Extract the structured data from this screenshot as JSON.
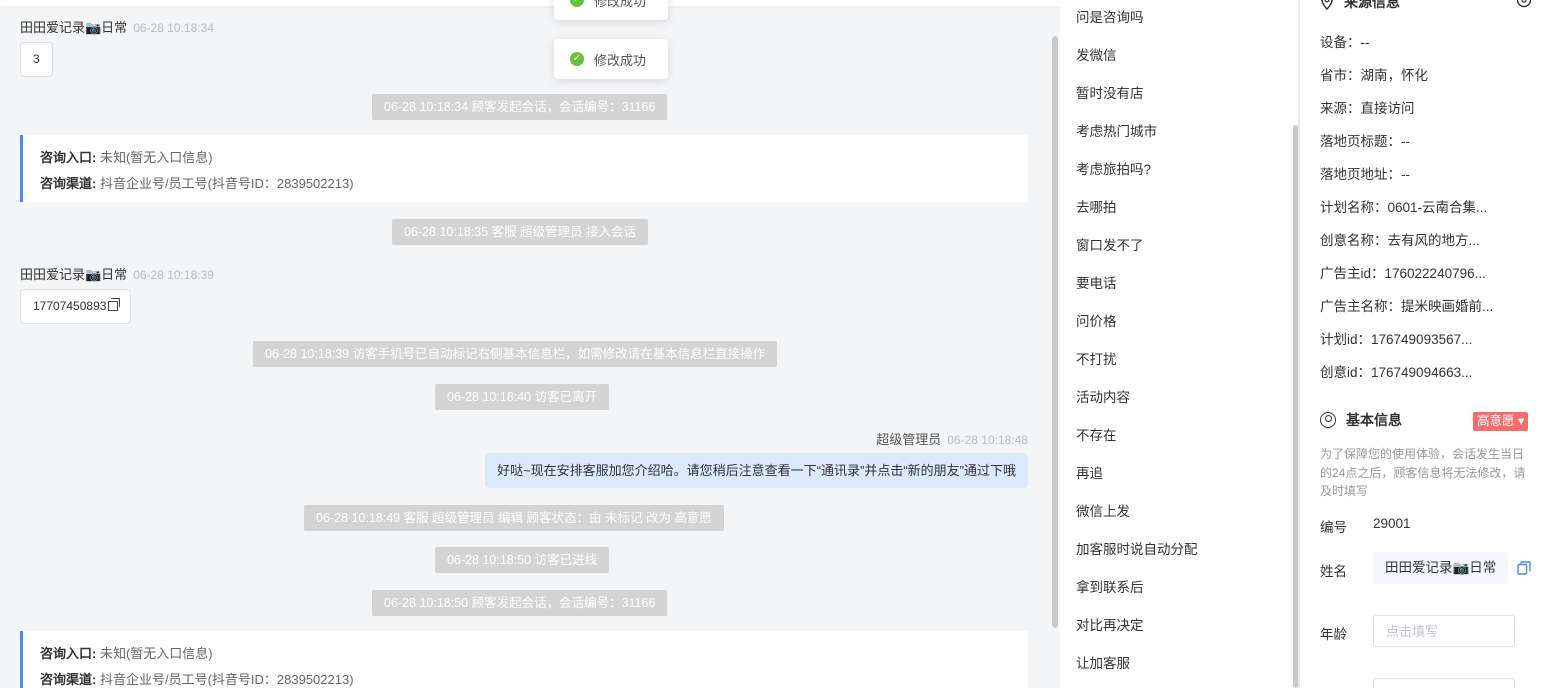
{
  "toasts": [
    {
      "text": "修改成功"
    },
    {
      "text": "修改成功"
    }
  ],
  "chat": {
    "msg1": {
      "sender": "田田爱记录📷日常",
      "time": "06-28 10:18:34",
      "content": "3"
    },
    "sys1": "06-28 10:18:34 顾客发起会话，会话编号：31166",
    "card1": {
      "entry_label": "咨询入口:",
      "entry_value": "未知(暂无入口信息)",
      "channel_label": "咨询渠道:",
      "channel_value": "抖音企业号/员工号(抖音号ID：2839502213)"
    },
    "sys2": "06-28 10:18:35 客服 超级管理员 接入会话",
    "msg2": {
      "sender": "田田爱记录📷日常",
      "time": "06-28 10:18:39",
      "content": "17707450893"
    },
    "sys3": "06-28 10:18:39 访客手机号已自动标记右侧基本信息栏，如需修改请在基本信息栏直接操作",
    "sys4": "06-28 10:18:40 访客已离开",
    "agent": {
      "name": "超级管理员",
      "time": "06-28 10:18:48",
      "content": "好哒~现在安排客服加您介绍哈。请您稍后注意查看一下“通讯录”并点击“新的朋友”通过下哦"
    },
    "sys5": "06-28 10:18:49 客服 超级管理员 编辑 顾客状态：由 未标记 改为 高意愿",
    "sys6": "06-28 10:18:50 访客已进线",
    "sys7": "06-28 10:18:50 顾客发起会话，会话编号：31166",
    "card2": {
      "entry_label": "咨询入口:",
      "entry_value": "未知(暂无入口信息)",
      "channel_label": "咨询渠道:",
      "channel_value": "抖音企业号/员工号(抖音号ID：2839502213)"
    }
  },
  "quick_replies": [
    "问是咨询吗",
    "发微信",
    "暂时没有店",
    "考虑热门城市",
    "考虑旅拍吗?",
    "去哪拍",
    "窗口发不了",
    "要电话",
    "问价格",
    "不打扰",
    "活动内容",
    "不存在",
    "再追",
    "微信上发",
    "加客服时说自动分配",
    "拿到联系后",
    "对比再决定",
    "让加客服"
  ],
  "source_info": {
    "title": "来源信息",
    "rows": [
      "设备：--",
      "省市：湖南，怀化",
      "来源：直接访问",
      "落地页标题：--",
      "落地页地址：--",
      "计划名称：0601-云南合集...",
      "创意名称：去有风的地方...",
      "广告主id：176022240796...",
      "广告主名称：提米映画婚前...",
      "计划id：176749093567...",
      "创意id：176749094663..."
    ]
  },
  "basic_info": {
    "title": "基本信息",
    "status_badge": "高意愿 ▾",
    "note": "为了保障您的使用体验，会话发生当日的24点之后，顾客信息将无法修改，请及时填写",
    "id_label": "编号",
    "id_value": "29001",
    "name_label": "姓名",
    "name_value": "田田爱记录📷日常",
    "age_label": "年龄",
    "age_placeholder": "点击填写"
  },
  "colors": {
    "accent": "#4a8df8",
    "success": "#67c23a",
    "badge": "#f56c6c",
    "agent_bubble": "#dbe8fd",
    "system_bg": "#d4d4d4"
  }
}
